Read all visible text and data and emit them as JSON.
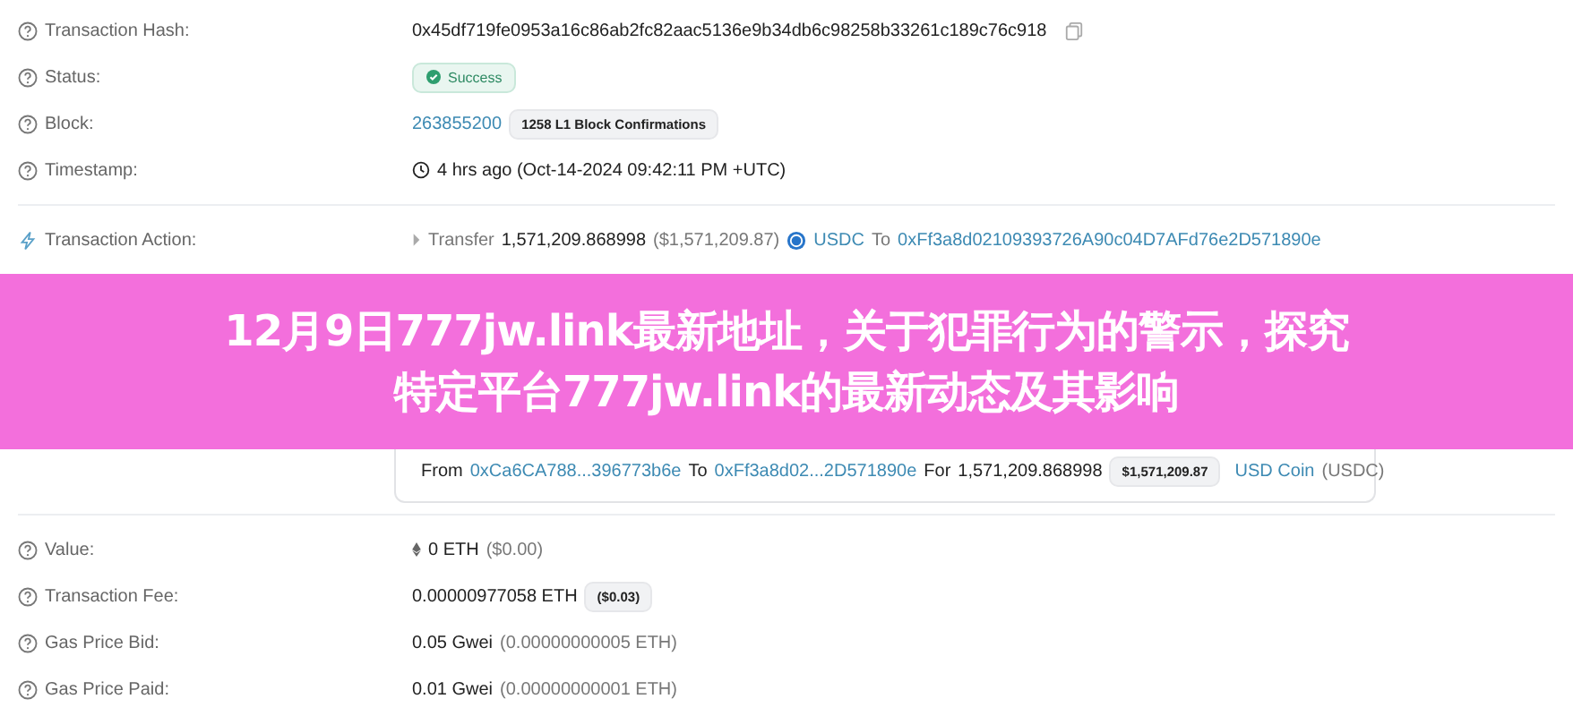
{
  "rows": [
    {
      "kind": "field",
      "label": "Transaction Hash:",
      "copy": true,
      "parts": [
        {
          "text": "0x45df719fe0953a16c86ab2fc82aac5136e9b34db6c98258b33261c189c76c918",
          "kind": "plain"
        }
      ]
    },
    {
      "kind": "field",
      "label": "Status:",
      "parts": [
        {
          "text": "Success",
          "kind": "status"
        }
      ]
    },
    {
      "kind": "field",
      "label": "Block:",
      "parts": [
        {
          "text": "263855200",
          "kind": "link"
        },
        {
          "text": "1258 L1 Block Confirmations",
          "kind": "pill"
        }
      ]
    },
    {
      "kind": "timestamp",
      "label": "Timestamp:",
      "divider": true,
      "parts": [
        {
          "text": "4 hrs ago (Oct-14-2024 09:42:11 PM +UTC)",
          "kind": "plain"
        }
      ]
    },
    {
      "kind": "action",
      "label": "Transaction Action:",
      "parts": [
        {
          "text": "Transfer",
          "kind": "muted"
        },
        {
          "text": "1,571,209.868998",
          "kind": "plain"
        },
        {
          "text": "($1,571,209.87)",
          "kind": "muted"
        },
        {
          "text": "USDC",
          "kind": "coin"
        },
        {
          "text": "To",
          "kind": "muted"
        },
        {
          "text": "0xFf3a8d02109393726A90c04D7AFd76e2D571890e",
          "kind": "link"
        }
      ]
    },
    {
      "kind": "banner",
      "lines": [
        "12月9日777jw.link最新地址，关于犯罪行为的警示，探究",
        "特定平台777jw.link的最新动态及其影响"
      ]
    },
    {
      "kind": "transfers",
      "divider": true,
      "parts": [
        {
          "text": "From",
          "kind": "plain"
        },
        {
          "text": "0xCa6CA788...396773b6e",
          "kind": "link"
        },
        {
          "text": "To",
          "kind": "plain"
        },
        {
          "text": "0xFf3a8d02...2D571890e",
          "kind": "link"
        },
        {
          "text": "For",
          "kind": "plain"
        },
        {
          "text": "1,571,209.868998",
          "kind": "plain"
        },
        {
          "text": "$1,571,209.87",
          "kind": "pill"
        },
        {
          "text": "USD Coin",
          "kind": "coin"
        },
        {
          "text": "(USDC)",
          "kind": "muted"
        }
      ]
    },
    {
      "kind": "value",
      "label": "Value:",
      "parts": [
        {
          "text": "0 ETH",
          "kind": "plain"
        },
        {
          "text": "($0.00)",
          "kind": "muted"
        }
      ]
    },
    {
      "kind": "field",
      "label": "Transaction Fee:",
      "parts": [
        {
          "text": "0.00000977058 ETH",
          "kind": "plain"
        },
        {
          "text": "($0.03)",
          "kind": "pill"
        }
      ]
    },
    {
      "kind": "field",
      "label": "Gas Price Bid:",
      "parts": [
        {
          "text": "0.05 Gwei",
          "kind": "plain"
        },
        {
          "text": "(0.00000000005 ETH)",
          "kind": "muted"
        }
      ]
    },
    {
      "kind": "field",
      "label": "Gas Price Paid:",
      "parts": [
        {
          "text": "0.01 Gwei",
          "kind": "plain"
        },
        {
          "text": "(0.00000000001 ETH)",
          "kind": "muted"
        }
      ]
    }
  ]
}
